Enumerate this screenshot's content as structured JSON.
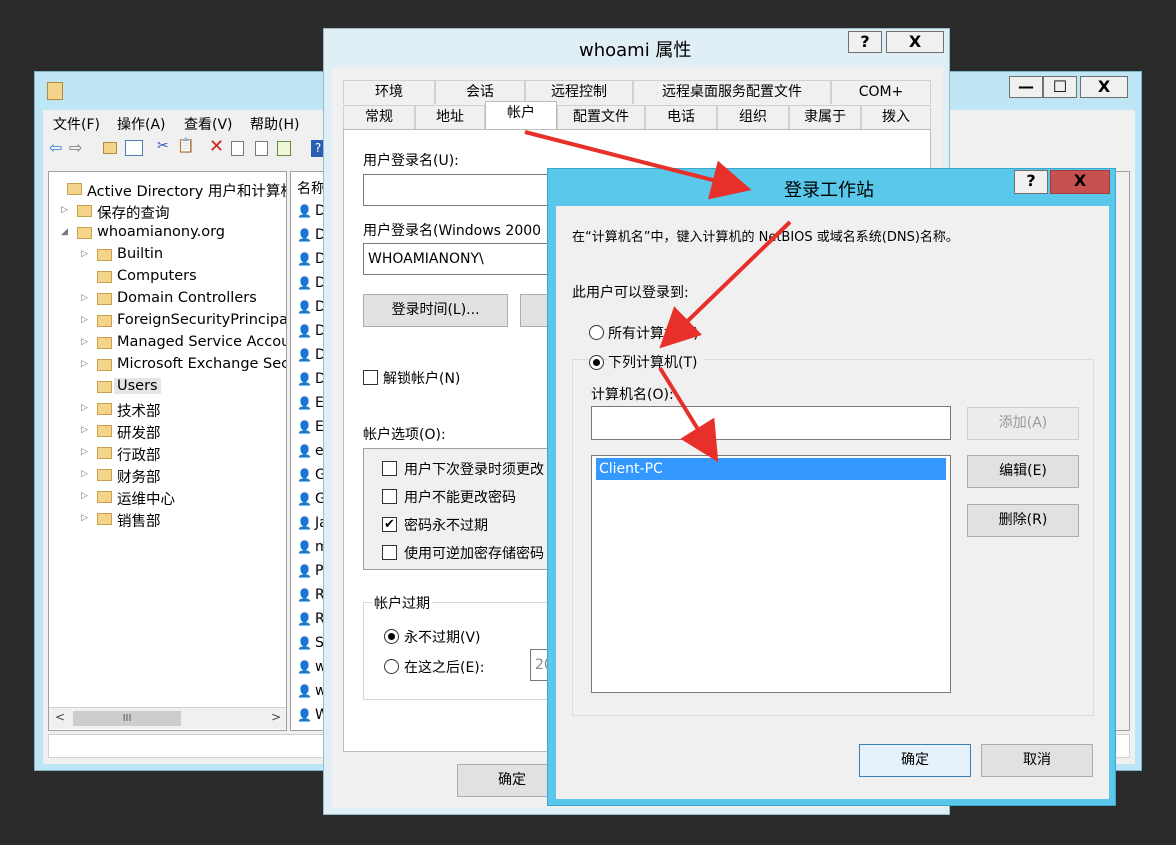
{
  "aduc": {
    "menu": [
      "文件(F)",
      "操作(A)",
      "查看(V)",
      "帮助(H)"
    ],
    "tree": [
      {
        "label": "Active Directory 用户和计算机",
        "level": 0,
        "expander": ""
      },
      {
        "label": "保存的查询",
        "level": 1,
        "expander": "▷"
      },
      {
        "label": "whoamianony.org",
        "level": 1,
        "expander": "◢"
      },
      {
        "label": "Builtin",
        "level": 2,
        "expander": "▷"
      },
      {
        "label": "Computers",
        "level": 2,
        "expander": ""
      },
      {
        "label": "Domain Controllers",
        "level": 2,
        "expander": "▷"
      },
      {
        "label": "ForeignSecurityPrincipa",
        "level": 2,
        "expander": "▷"
      },
      {
        "label": "Managed Service Accou",
        "level": 2,
        "expander": "▷"
      },
      {
        "label": "Microsoft Exchange Sec",
        "level": 2,
        "expander": "▷"
      },
      {
        "label": "Users",
        "level": 2,
        "expander": ""
      },
      {
        "label": "技术部",
        "level": 2,
        "expander": "▷"
      },
      {
        "label": "研发部",
        "level": 2,
        "expander": "▷"
      },
      {
        "label": "行政部",
        "level": 2,
        "expander": "▷"
      },
      {
        "label": "财务部",
        "level": 2,
        "expander": "▷"
      },
      {
        "label": "运维中心",
        "level": 2,
        "expander": "▷"
      },
      {
        "label": "销售部",
        "level": 2,
        "expander": "▷"
      }
    ],
    "list_header": "名称",
    "list_items": [
      "D",
      "D",
      "D",
      "D",
      "D",
      "D",
      "D",
      "D",
      "E",
      "E",
      "e",
      "G",
      "G",
      "Ja",
      "m",
      "P",
      "R",
      "R",
      "S",
      "w",
      "w",
      "W"
    ],
    "scroll_mid": "III"
  },
  "props": {
    "title": "whoami 属性",
    "help_btn": "?",
    "close_btn": "X",
    "tabs_row1": [
      "环境",
      "会话",
      "远程控制",
      "远程桌面服务配置文件",
      "COM+"
    ],
    "tabs_row2": [
      "常规",
      "地址",
      "帐户",
      "配置文件",
      "电话",
      "组织",
      "隶属于",
      "拨入"
    ],
    "logon_name_label": "用户登录名(U):",
    "logon_name_pre2000_label": "用户登录名(Windows 2000",
    "domain_prefix": "WHOAMIANONY\\",
    "logon_hours_btn": "登录时间(L)...",
    "unlock_label": "解锁帐户(N)",
    "account_options_label": "帐户选项(O):",
    "options": [
      {
        "label": "用户下次登录时须更改",
        "checked": false
      },
      {
        "label": "用户不能更改密码",
        "checked": false
      },
      {
        "label": "密码永不过期",
        "checked": true
      },
      {
        "label": "使用可逆加密存储密码",
        "checked": false
      }
    ],
    "expire_label": "帐户过期",
    "never_label": "永不过期(V)",
    "after_label": "在这之后(E):",
    "date_partial": "20",
    "ok": "确定"
  },
  "dialog": {
    "title": "登录工作站",
    "help_btn": "?",
    "close_btn": "X",
    "description": "在“计算机名”中，键入计算机的 NetBIOS 或域名系统(DNS)名称。",
    "logon_to_label": "此用户可以登录到:",
    "all_computers": "所有计算机(C)",
    "following_computers": "下列计算机(T)",
    "computer_name_label": "计算机名(O):",
    "computer_name_value": "",
    "computers": [
      "Client-PC"
    ],
    "add_btn": "添加(A)",
    "edit_btn": "编辑(E)",
    "remove_btn": "删除(R)",
    "ok": "确定",
    "cancel": "取消",
    "accent": "#5ac8ea"
  },
  "back_window": {
    "min": "—",
    "max": "☐",
    "close": "X"
  }
}
